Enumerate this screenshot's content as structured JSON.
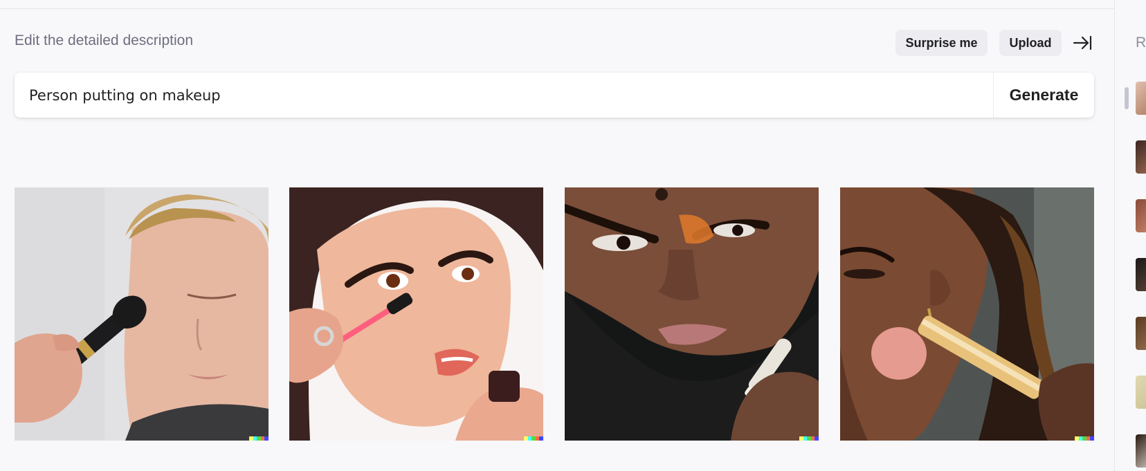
{
  "header": {
    "description_label": "Edit the detailed description",
    "surprise_label": "Surprise me",
    "upload_label": "Upload",
    "collapse_icon": "collapse-right-icon"
  },
  "prompt": {
    "value": "Person putting on makeup",
    "generate_label": "Generate"
  },
  "results": [
    {
      "subject": "man-applying-blush-brush"
    },
    {
      "subject": "woman-applying-mascara"
    },
    {
      "subject": "man-applying-face-pencil"
    },
    {
      "subject": "woman-applying-blush-brush"
    }
  ],
  "signature_colors": [
    "#ffff66",
    "#42ffff",
    "#51da4c",
    "#ff6e3c",
    "#3c46ff"
  ],
  "history_panel": {
    "label_fragment": "R",
    "thumbnail_count": 7
  },
  "colors": {
    "background": "#f8f8fa",
    "pill_button": "#ececf1",
    "text_primary": "#202123",
    "text_secondary": "#6e6e80"
  }
}
